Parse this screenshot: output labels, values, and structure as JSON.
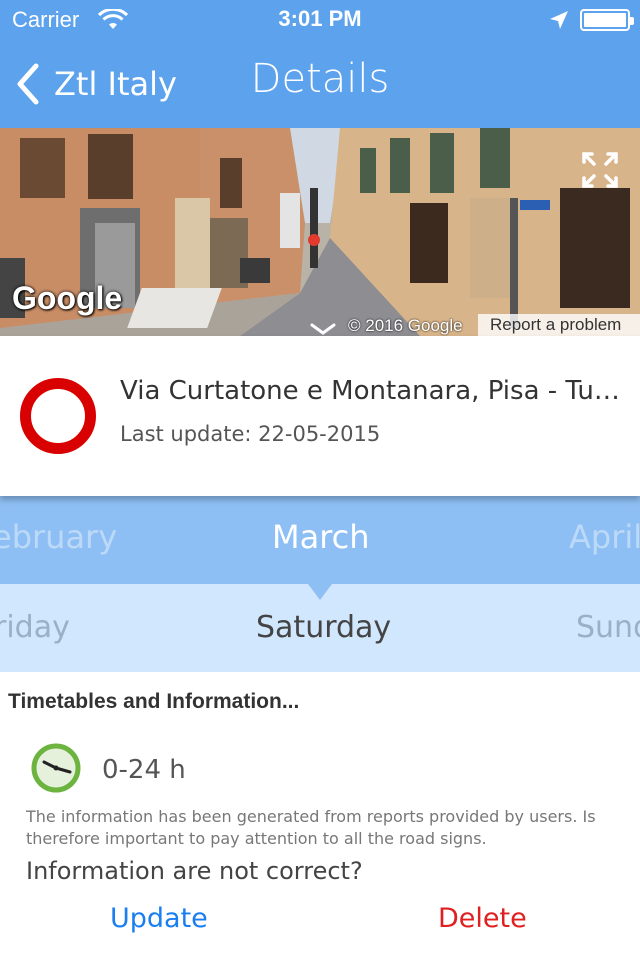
{
  "status_bar": {
    "carrier": "Carrier",
    "time": "3:01 PM",
    "icons": [
      "wifi-icon",
      "location-arrow-icon",
      "battery-icon"
    ]
  },
  "nav": {
    "back_label": "Ztl Italy",
    "title": "Details",
    "icons": [
      "chevron-left-icon"
    ]
  },
  "street_view": {
    "logo": "Google",
    "copyright": "© 2016 Google",
    "report": "Report a problem",
    "icons": [
      "expand-icon",
      "chevron-down-icon"
    ]
  },
  "place": {
    "address": "Via Curtatone e Montanara, Pisa - Tus…",
    "last_update": "Last update: 22-05-2015",
    "sign_icon": "no-vehicles-sign-icon",
    "sign_color": "#d80000"
  },
  "month_picker": {
    "prev": "ebruary",
    "current": "March",
    "next": "April"
  },
  "day_picker": {
    "prev": "riday",
    "current": "Saturday",
    "next": "Sunda"
  },
  "timetable": {
    "title": "Timetables and Information...",
    "clock_icon": "clock-icon",
    "hours": "0-24 h",
    "note": "The information has been generated from reports provided by users. Is therefore important to pay attention to all the road signs.",
    "question": "Information are not correct?",
    "update_label": "Update",
    "delete_label": "Delete"
  },
  "colors": {
    "header": "#5ca2ec",
    "month_bar": "#8ebff4",
    "day_bar": "#d1e7fd",
    "update": "#1a7ef0",
    "delete": "#e02020",
    "clock_ring": "#6cb33f"
  }
}
